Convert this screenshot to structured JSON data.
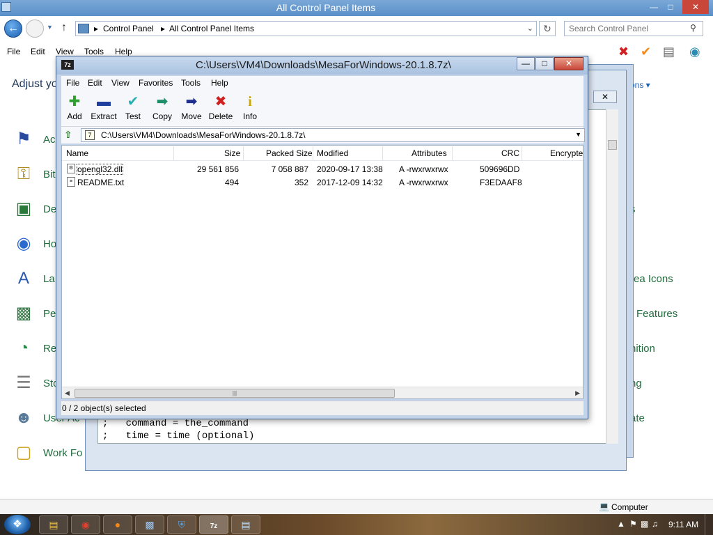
{
  "control_panel": {
    "title": "All Control Panel Items",
    "window_buttons": {
      "minimize": "—",
      "maximize": "□",
      "close": "✕"
    },
    "breadcrumbs": [
      "Control Panel",
      "All Control Panel Items"
    ],
    "search_placeholder": "Search Control Panel",
    "menu": [
      "File",
      "Edit",
      "View",
      "Tools",
      "Help"
    ],
    "heading": "Adjust yo",
    "view_by_value": "ons ▾",
    "items_left": [
      {
        "label": "Ac",
        "icon": "flag-icon"
      },
      {
        "label": "Bit",
        "icon": "key-icon"
      },
      {
        "label": "De",
        "icon": "device-icon"
      },
      {
        "label": "Ho",
        "icon": "network-icon"
      },
      {
        "label": "La",
        "icon": "language-icon"
      },
      {
        "label": "Pe",
        "icon": "display-icon"
      },
      {
        "label": "Re",
        "icon": "globe-clock-icon"
      },
      {
        "label": "Sto",
        "icon": "storage-icon"
      },
      {
        "label": "User Ac",
        "icon": "users-icon"
      },
      {
        "label": "Work Fo",
        "icon": "folder-icon"
      }
    ],
    "items_right": [
      "s",
      "rea Icons",
      "Features",
      "nition",
      "ng",
      "ate"
    ],
    "status_computer": "Computer"
  },
  "editor": {
    "lines": [
      ";   command = the_command",
      ";   time = time (optional)"
    ]
  },
  "zip": {
    "title": "C:\\Users\\VM4\\Downloads\\MesaForWindows-20.1.8.7z\\",
    "app_icon_text": "7z",
    "window_buttons": {
      "minimize": "—",
      "maximize": "□",
      "close": "✕"
    },
    "menu": [
      "File",
      "Edit",
      "View",
      "Favorites",
      "Tools",
      "Help"
    ],
    "toolbar": [
      {
        "label": "Add",
        "icon": "add-icon",
        "glyph": "✚",
        "color": "#2e9e2e"
      },
      {
        "label": "Extract",
        "icon": "extract-icon",
        "glyph": "▬",
        "color": "#1f3f9e"
      },
      {
        "label": "Test",
        "icon": "test-icon",
        "glyph": "✔",
        "color": "#27b0b0"
      },
      {
        "label": "Copy",
        "icon": "copy-icon",
        "glyph": "➡",
        "color": "#1f8f6a"
      },
      {
        "label": "Move",
        "icon": "move-icon",
        "glyph": "➡",
        "color": "#1f2f8f"
      },
      {
        "label": "Delete",
        "icon": "delete-icon",
        "glyph": "✖",
        "color": "#d02020"
      },
      {
        "label": "Info",
        "icon": "info-icon",
        "glyph": "i",
        "color": "#c8a800"
      }
    ],
    "path": "C:\\Users\\VM4\\Downloads\\MesaForWindows-20.1.8.7z\\",
    "columns": [
      "Name",
      "Size",
      "Packed Size",
      "Modified",
      "Attributes",
      "CRC",
      "Encrypte"
    ],
    "rows": [
      {
        "name": "opengl32.dll",
        "size": "29 561 856",
        "packed": "7 058 887",
        "modified": "2020-09-17 13:38",
        "attributes": "A -rwxrwxrwx",
        "crc": "509696DD"
      },
      {
        "name": "README.txt",
        "size": "494",
        "packed": "352",
        "modified": "2017-12-09 14:32",
        "attributes": "A -rwxrwxrwx",
        "crc": "F3EDAAF8"
      }
    ],
    "status": "0 / 2 object(s) selected"
  },
  "taskbar": {
    "clock": "9:11 AM"
  },
  "colors": {
    "accent": "#1e395b",
    "link_green": "#1e6b3a",
    "zip_frame": "#c3d4ea"
  }
}
